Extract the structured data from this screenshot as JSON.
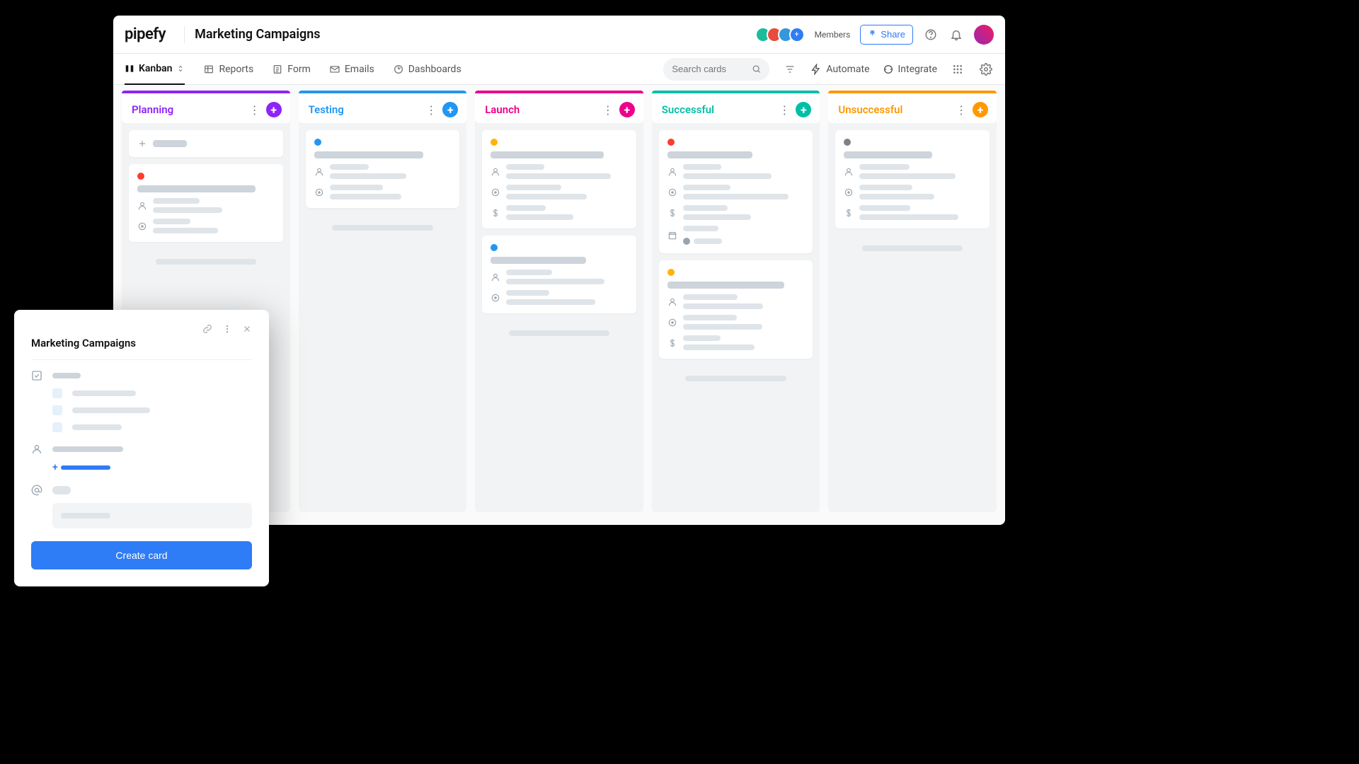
{
  "header": {
    "logo_text": "pipefy",
    "pipe_title": "Marketing Campaigns",
    "share_label": "Share",
    "members_label": "Members",
    "avatar_plus": "+"
  },
  "viewbar": {
    "tabs": [
      {
        "id": "kanban",
        "label": "Kanban"
      },
      {
        "id": "reports",
        "label": "Reports"
      },
      {
        "id": "form",
        "label": "Form"
      },
      {
        "id": "emails",
        "label": "Emails"
      },
      {
        "id": "dashboards",
        "label": "Dashboards"
      }
    ],
    "search_placeholder": "Search cards",
    "automate_label": "Automate",
    "integrate_label": "Integrate"
  },
  "columns": [
    {
      "id": "planning",
      "label": "Planning",
      "accent": "#8e24f7",
      "text": "#8e24f7",
      "cards": [
        {
          "type": "new"
        },
        {
          "dot": "#ff3b2f",
          "fields": [
            "user",
            "target"
          ]
        }
      ]
    },
    {
      "id": "testing",
      "label": "Testing",
      "accent": "#2196f3",
      "text": "#2196f3",
      "cards": [
        {
          "dot": "#2196f3",
          "fields": [
            "user",
            "target"
          ]
        }
      ]
    },
    {
      "id": "launch",
      "label": "Launch",
      "accent": "#ec008c",
      "text": "#ec008c",
      "cards": [
        {
          "dot": "#ffb300",
          "fields": [
            "user",
            "target",
            "dollar"
          ]
        },
        {
          "dot": "#2196f3",
          "fields": [
            "user",
            "target"
          ]
        }
      ]
    },
    {
      "id": "successful",
      "label": "Successful",
      "accent": "#00bfa5",
      "text": "#00bfa5",
      "cards": [
        {
          "dot": "#ff3b2f",
          "fields": [
            "user",
            "target",
            "dollar",
            "date_tag"
          ]
        },
        {
          "dot": "#ffb300",
          "fields": [
            "user",
            "target",
            "dollar"
          ]
        }
      ]
    },
    {
      "id": "unsuccessful",
      "label": "Unsuccessful",
      "accent": "#ff9800",
      "text": "#ff9800",
      "cards": [
        {
          "dot": "#808080",
          "fields": [
            "user",
            "target",
            "dollar"
          ]
        }
      ]
    }
  ],
  "modal": {
    "title": "Marketing Campaigns",
    "create_label": "Create card"
  }
}
